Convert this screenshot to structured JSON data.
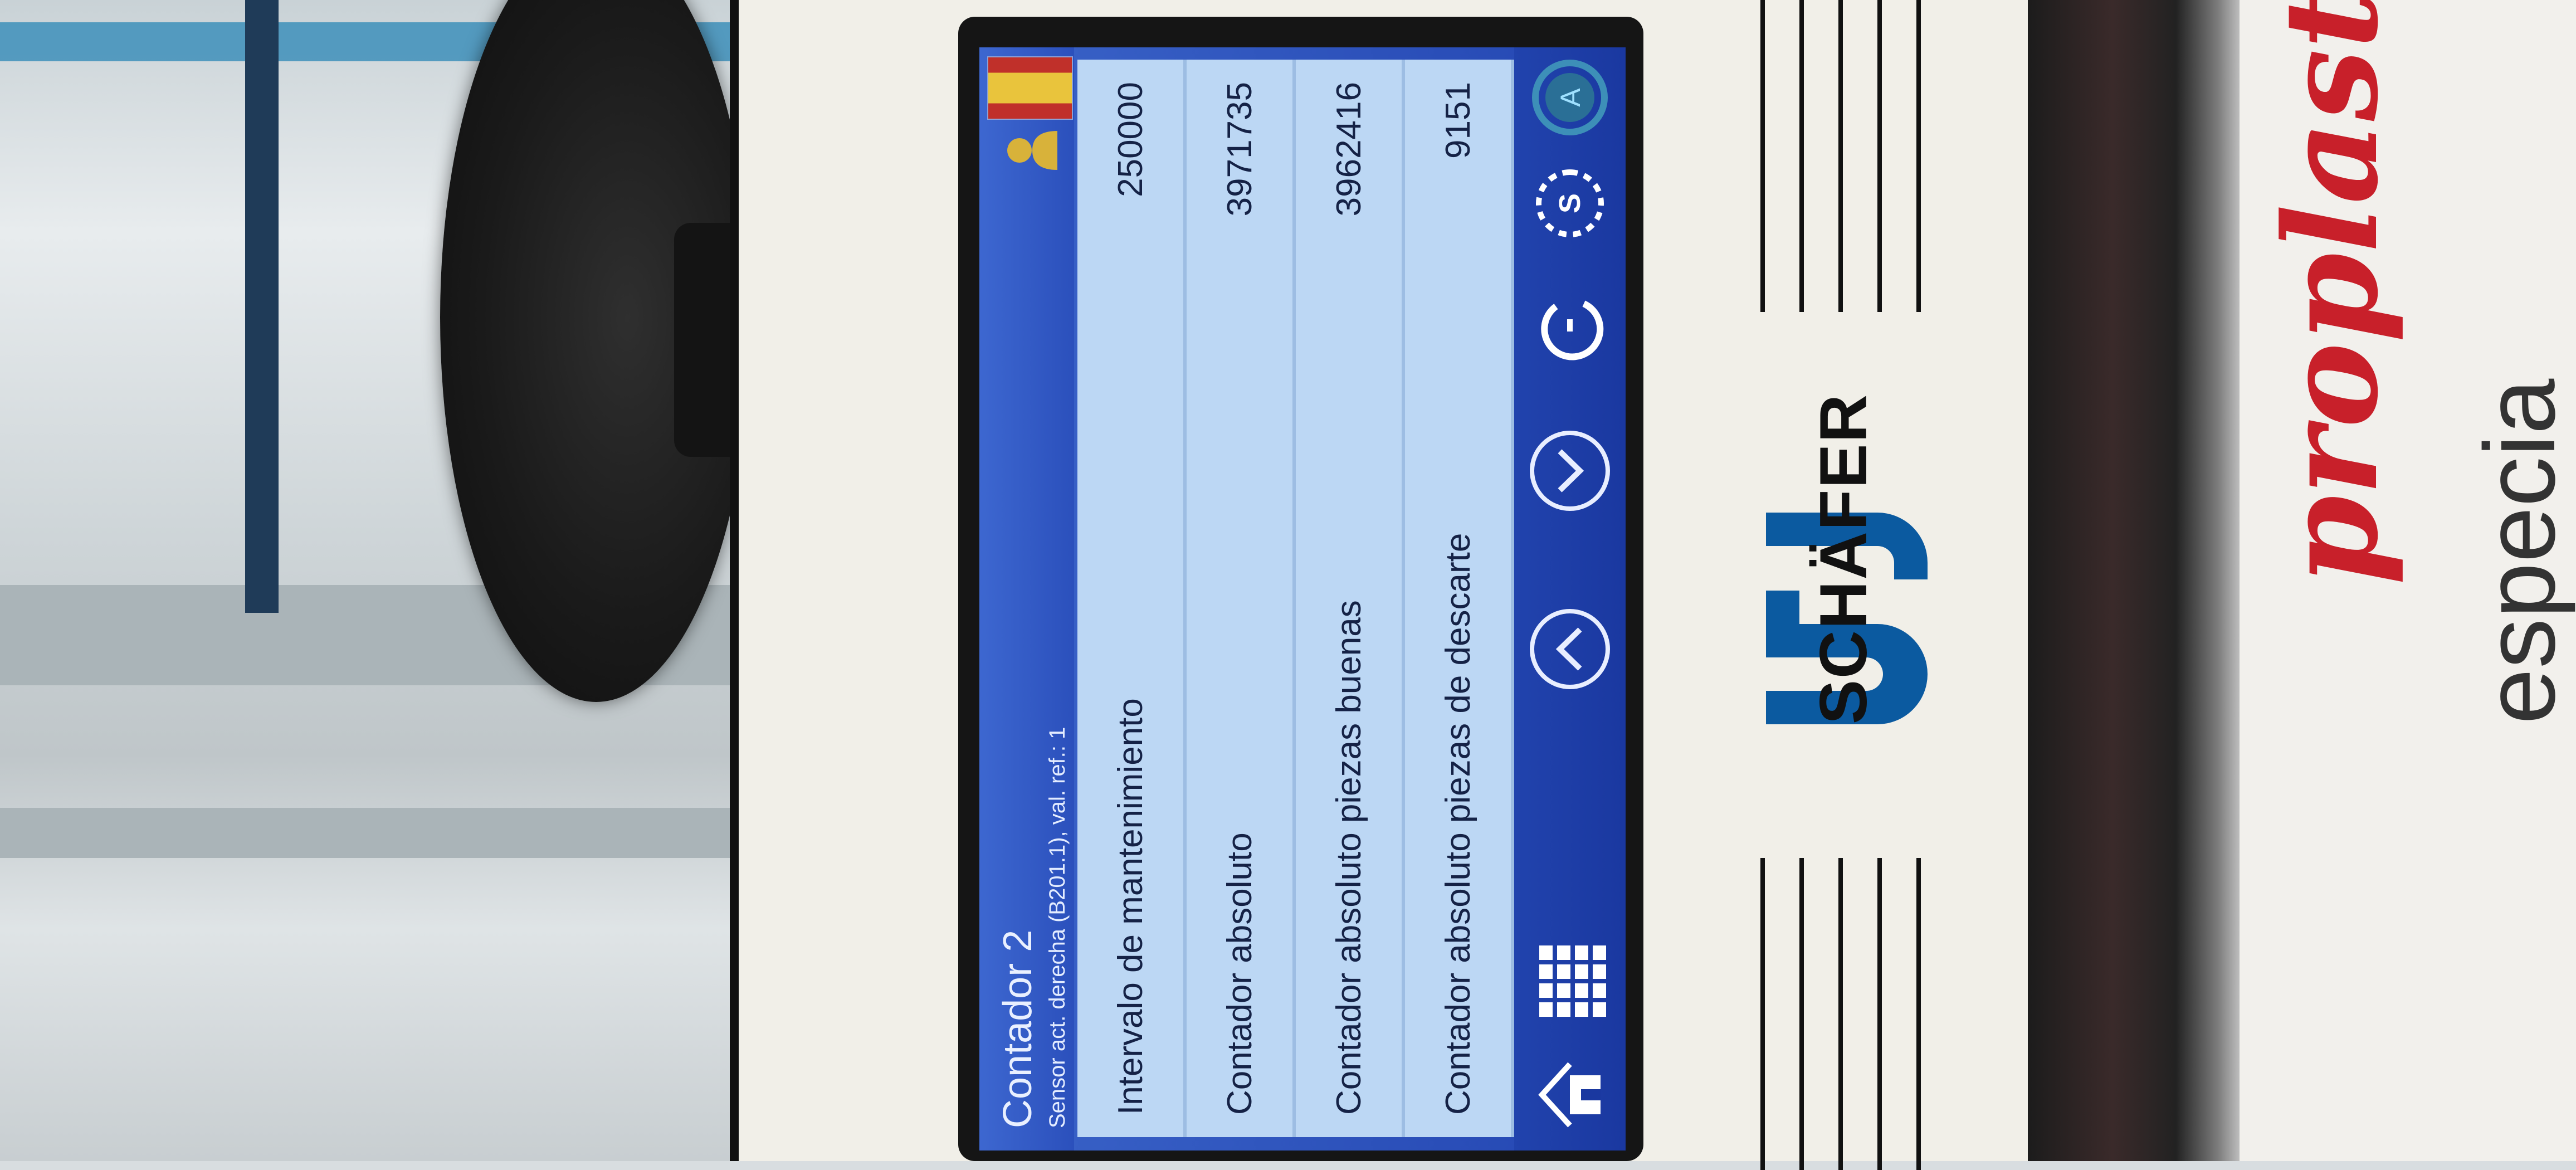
{
  "screen": {
    "title": "Contador 2",
    "subtitle": "Sensor act. derecha (B201.1), val. ref.: 1"
  },
  "counters": [
    {
      "label": "Intervalo de mantenimiento",
      "value": "250000"
    },
    {
      "label": "Contador absoluto",
      "value": "3971735"
    },
    {
      "label": "Contador absoluto piezas buenas",
      "value": "3962416"
    },
    {
      "label": "Contador absoluto piezas de descarte",
      "value": "9151"
    }
  ],
  "toolbar": {
    "icons": [
      "home-icon",
      "grid-menu-icon",
      "arrow-up-icon",
      "arrow-down-icon",
      "reset-icon",
      "service-icon",
      "auto-mode-icon"
    ],
    "auto_label": "A",
    "service_label": "S"
  },
  "housing": {
    "brand": "SCHÄFER"
  },
  "background": {
    "partial_brand": "proplast",
    "partial_text": "especia"
  },
  "colors": {
    "screen_blue": "#2446b2",
    "table_row": "#bcd7f4",
    "brand_blue": "#0b5aa0",
    "red_brand": "#c8202a"
  }
}
